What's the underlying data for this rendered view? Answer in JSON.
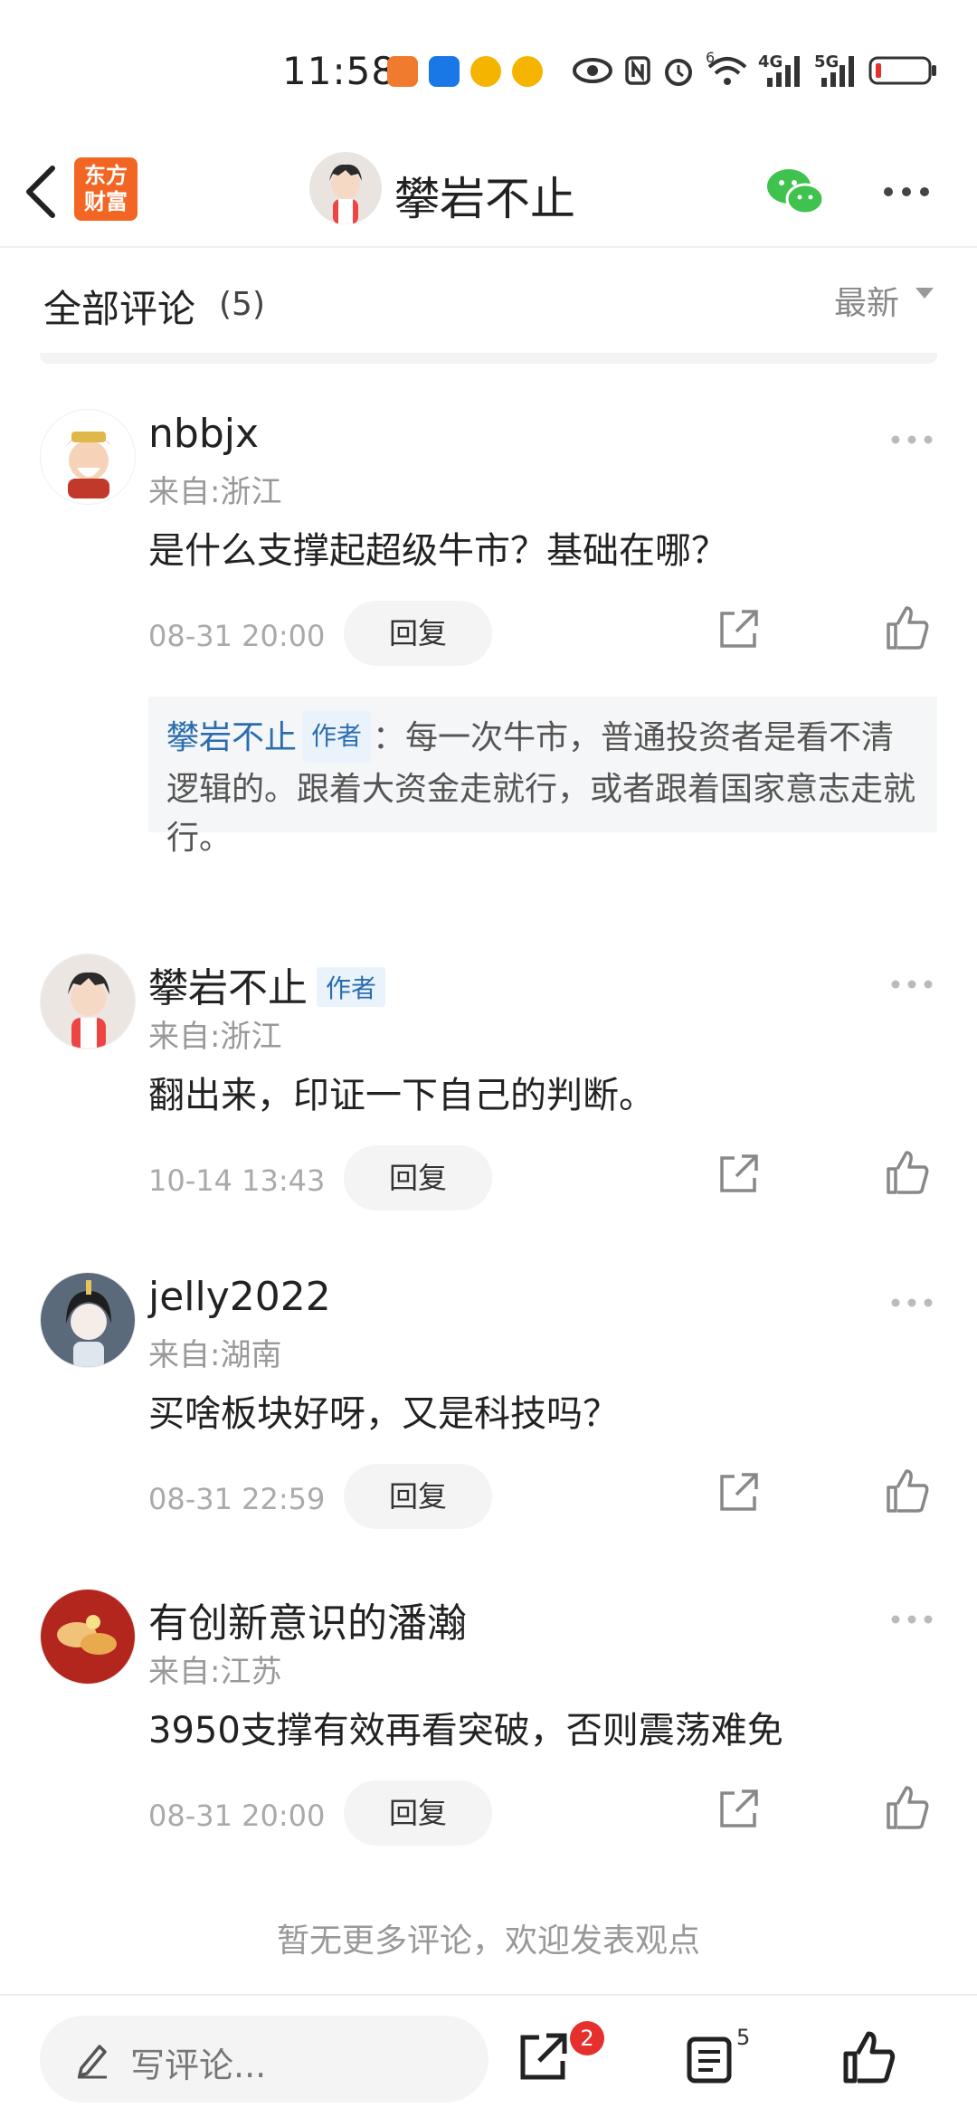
{
  "status_bar": {
    "time": "11:58",
    "net_4g": "4G",
    "net_5g": "5G",
    "wifi_sup": "6"
  },
  "header": {
    "logo_line1": "东方",
    "logo_line2": "财富",
    "title": "攀岩不止"
  },
  "section": {
    "title": "全部评论",
    "count": "(5)",
    "sort": "最新"
  },
  "author_tag": "作者",
  "comments": [
    {
      "user": "nbbjx",
      "location": "来自:浙江",
      "text": "是什么支撑起超级牛市？基础在哪？",
      "time": "08-31 20:00",
      "reply_label": "回复",
      "reply": {
        "user": "攀岩不止",
        "text": "：每一次牛市，普通投资者是看不清逻辑的。跟着大资金走就行，或者跟着国家意志走就行。"
      }
    },
    {
      "user": "攀岩不止",
      "location": "来自:浙江",
      "text": "翻出来，印证一下自己的判断。",
      "time": "10-14 13:43",
      "reply_label": "回复"
    },
    {
      "user": "jelly2022",
      "location": "来自:湖南",
      "text": "买啥板块好呀，又是科技吗？",
      "time": "08-31 22:59",
      "reply_label": "回复"
    },
    {
      "user": "有创新意识的潘瀚",
      "location": "来自:江苏",
      "text": "3950支撑有效再看突破，否则震荡难免",
      "time": "08-31 20:00",
      "reply_label": "回复"
    }
  ],
  "footer_note": "暂无更多评论，欢迎发表观点",
  "bottom_bar": {
    "placeholder": "写评论...",
    "share_badge": "2",
    "list_count": "5"
  },
  "colors": {
    "accent_blue": "#2a6db0",
    "logo_orange": "#f26522",
    "badge_red": "#e5302d",
    "wechat_green": "#3fc24e"
  }
}
